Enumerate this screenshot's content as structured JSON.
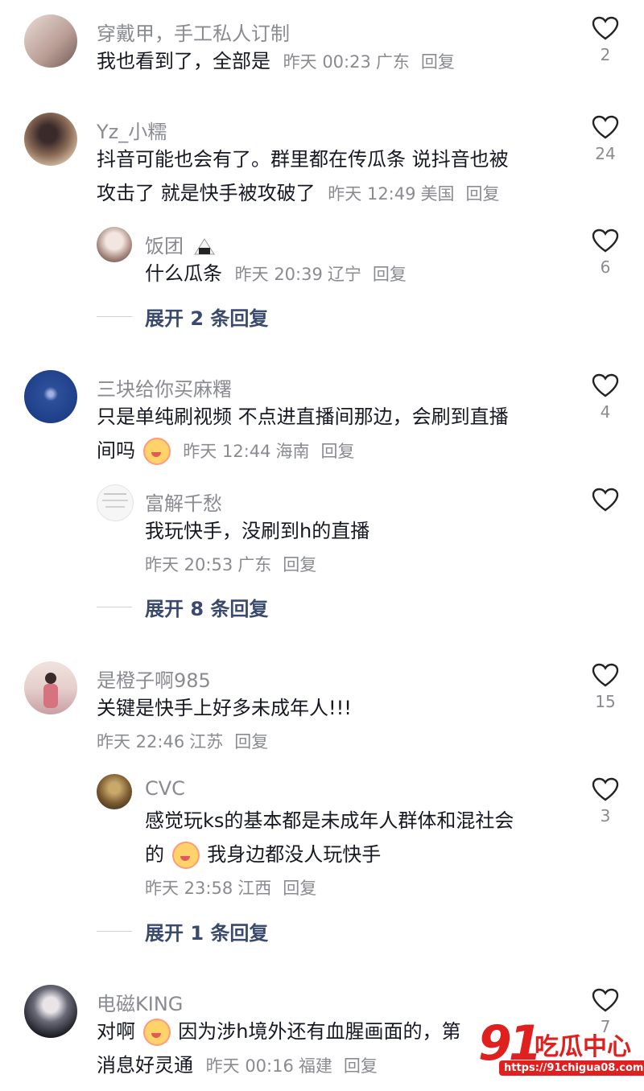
{
  "comments": [
    {
      "name": "穿戴甲，手工私人订制",
      "text": "我也看到了，全部是",
      "time": "昨天 00:23",
      "location": "广东",
      "reply_label": "回复",
      "likes": "2"
    },
    {
      "name": "Yz_小糯",
      "text_line1": "抖音可能也会有了。群里都在传瓜条 说抖音也被",
      "text_line2": "攻击了 就是快手被攻破了",
      "time": "昨天 12:49",
      "location": "美国",
      "reply_label": "回复",
      "likes": "24",
      "replies": [
        {
          "name": "饭团",
          "text": "什么瓜条",
          "time": "昨天 20:39",
          "location": "辽宁",
          "reply_label": "回复",
          "likes": "6"
        }
      ],
      "expand": "展开 2 条回复"
    },
    {
      "name": "三块给你买麻糬",
      "text_line1": "只是单纯刷视频 不点进直播间那边，会刷到直播",
      "text_line2": "间吗",
      "time": "昨天 12:44",
      "location": "海南",
      "reply_label": "回复",
      "likes": "4",
      "replies": [
        {
          "name": "富解千愁",
          "text": "我玩快手，没刷到h的直播",
          "time": "昨天 20:53",
          "location": "广东",
          "reply_label": "回复",
          "likes": ""
        }
      ],
      "expand": "展开 8 条回复"
    },
    {
      "name": "是橙子啊985",
      "text": "关键是快手上好多未成年人!!!",
      "time": "昨天 22:46",
      "location": "江苏",
      "reply_label": "回复",
      "likes": "15",
      "replies": [
        {
          "name": "CVC",
          "text_line1": "感觉玩ks的基本都是未成年人群体和混社会",
          "text_line2": "的",
          "text_line2_after": "我身边都没人玩快手",
          "time": "昨天 23:58",
          "location": "江西",
          "reply_label": "回复",
          "likes": "3"
        }
      ],
      "expand": "展开 1 条回复"
    },
    {
      "name": "电磁KING",
      "text_line1_a": "对啊",
      "text_line1_b": "因为涉h境外还有血腥画面的，第",
      "text_line2": "消息好灵通",
      "time": "昨天 00:16",
      "location": "福建",
      "reply_label": "回复",
      "likes": "7"
    }
  ],
  "watermark": {
    "big": "91",
    "cn": "吃瓜中心",
    "url": "https://91chigua08.com"
  },
  "colors": {
    "text": "#161823",
    "meta": "#8a8b91",
    "expand": "#3a4a6e",
    "watermark": "#e0201f"
  }
}
